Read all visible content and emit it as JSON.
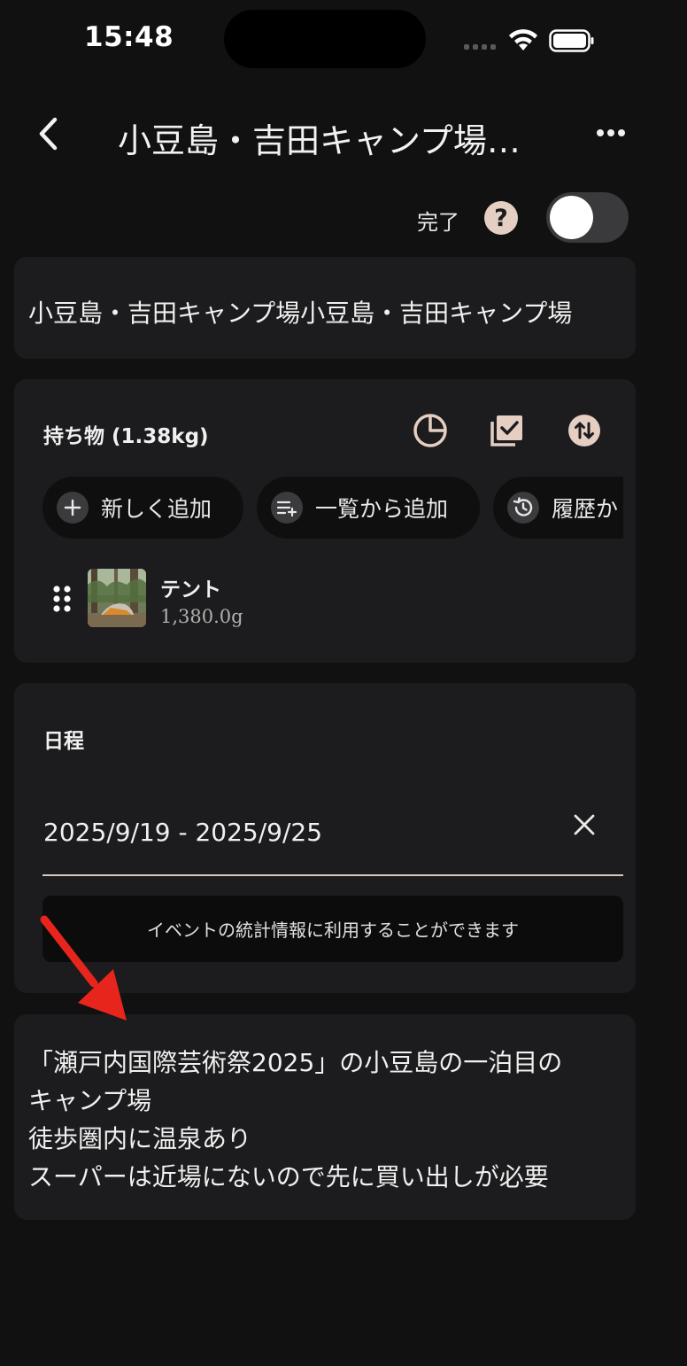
{
  "status_bar": {
    "time": "15:48"
  },
  "nav": {
    "title": "小豆島・吉田キャンプ場…",
    "back_icon": "chevron-left-icon",
    "more_icon": "more-horizontal-icon"
  },
  "done_row": {
    "label": "完了",
    "help_icon": "?",
    "toggle_on": false
  },
  "name_card": {
    "text": "小豆島・吉田キャンプ場小豆島・吉田キャンプ場"
  },
  "items_card": {
    "title": "持ち物 (1.38kg)",
    "actions": [
      "pie-chart-icon",
      "checklist-icon",
      "sort-icon"
    ],
    "chips": [
      {
        "label": "新しく追加",
        "icon": "plus-icon"
      },
      {
        "label": "一覧から追加",
        "icon": "list-add-icon"
      },
      {
        "label": "履歴か",
        "icon": "history-icon"
      }
    ],
    "gear": [
      {
        "name": "テント",
        "weight": "1,380.0g"
      }
    ]
  },
  "schedule_card": {
    "title": "日程",
    "date_range": "2025/9/19 - 2025/9/25",
    "hint": "イベントの統計情報に利用することができます"
  },
  "memo_card": {
    "lines": [
      "「瀬戸内国際芸術祭2025」の小豆島の一泊目の",
      "キャンプ場",
      "徒歩圏内に温泉あり",
      "スーパーは近場にないので先に買い出しが必要"
    ]
  },
  "colors": {
    "background": "#111111",
    "card": "#1c1b1d",
    "accent": "#e5cfc3",
    "annotation": "#e8251c"
  }
}
